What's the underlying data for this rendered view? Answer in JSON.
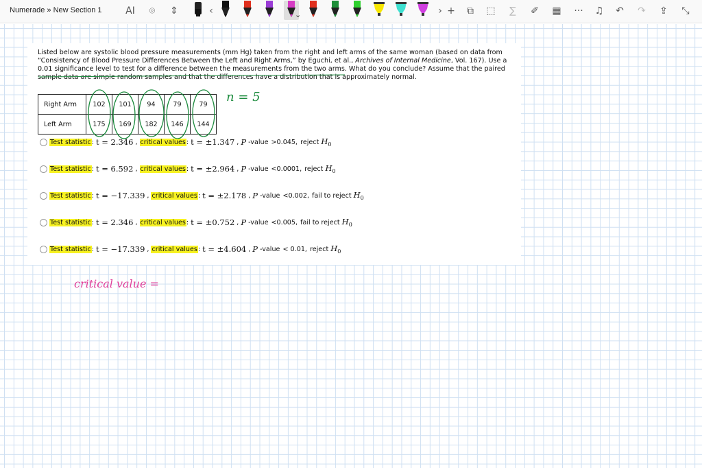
{
  "toolbar": {
    "breadcrumb": "Numerade » New Section 1",
    "left_tools": [
      {
        "icon": "text-select-icon",
        "glyph": "AI"
      },
      {
        "icon": "lasso-select-icon",
        "glyph": "⌾"
      },
      {
        "icon": "add-space-icon",
        "glyph": "⇕"
      }
    ],
    "pens": [
      {
        "color": "#111111",
        "kind": "marker"
      },
      {
        "color": "#111111",
        "kind": "pen"
      },
      {
        "color": "#e0301e",
        "kind": "pen"
      },
      {
        "color": "#9b3dd6",
        "kind": "pen"
      },
      {
        "color": "#d63cc4",
        "kind": "pen",
        "selected": true
      },
      {
        "color": "#e0301e",
        "kind": "pen"
      },
      {
        "color": "#1f8f3a",
        "kind": "pen"
      },
      {
        "color": "#2fd12f",
        "kind": "pen"
      },
      {
        "color": "#f7e600",
        "kind": "highlighter"
      },
      {
        "color": "#3fe0d0",
        "kind": "highlighter"
      },
      {
        "color": "#d040e0",
        "kind": "highlighter"
      }
    ],
    "right_tools": [
      {
        "icon": "add-pen-icon",
        "glyph": "+",
        "dim": false
      },
      {
        "icon": "shapes-icon",
        "glyph": "⧉",
        "dim": false
      },
      {
        "icon": "ink-to-shape-icon",
        "glyph": "⬚",
        "dim": false
      },
      {
        "icon": "ink-to-math-icon",
        "glyph": "∑",
        "dim": true
      },
      {
        "icon": "ruler-icon",
        "glyph": "✐",
        "dim": false
      },
      {
        "icon": "grid-icon",
        "glyph": "▦",
        "dim": false
      },
      {
        "icon": "more-icon",
        "glyph": "···",
        "dim": false
      },
      {
        "icon": "replay-icon",
        "glyph": "♫",
        "dim": false
      },
      {
        "icon": "undo-icon",
        "glyph": "↶",
        "dim": false
      },
      {
        "icon": "redo-icon",
        "glyph": "↷",
        "dim": true
      },
      {
        "icon": "share-icon",
        "glyph": "⇪",
        "dim": false
      },
      {
        "icon": "collapse-icon",
        "glyph": "⤡",
        "dim": false
      }
    ]
  },
  "question": {
    "text_1": "Listed below are systolic blood pressure measurements (mm Hg) taken from the right and left arms of the same woman (based on data from “Consistency of Blood Pressure Differences Between the Left and Right Arms,” by Eguchi, et al., ",
    "journal": "Archives of Internal Medicine",
    "text_2": ", Vol. 167). Use a 0.01 significance level to test for a difference between the measurements from the two arms. What do you conclude? Assume that the paired sample data are simple random samples and that the differences have a distribution that is approximately normal."
  },
  "table": {
    "rows": [
      {
        "label": "Right Arm",
        "values": [
          "102",
          "101",
          "94",
          "79",
          "79"
        ]
      },
      {
        "label": "Left Arm",
        "values": [
          "175",
          "169",
          "182",
          "146",
          "144"
        ]
      }
    ]
  },
  "options": [
    {
      "ts_label": "Test statistic",
      "t": "t = 2.346",
      "cv_label": "critical values",
      "cv": "t = ±1.347",
      "p": ">0.045",
      "conclusion": "reject"
    },
    {
      "ts_label": "Test statistic",
      "t": "t = 6.592",
      "cv_label": "critical values",
      "cv": "t = ±2.964",
      "p": "<0.0001",
      "conclusion": "reject"
    },
    {
      "ts_label": "Test statistic",
      "t": "t = −17.339",
      "cv_label": "critical values",
      "cv": "t = ±2.178",
      "p": "<0.002",
      "conclusion": "fail to reject"
    },
    {
      "ts_label": "Test statistic",
      "t": "t = 2.346",
      "cv_label": "critical values",
      "cv": "t = ±0.752",
      "p": "<0.005",
      "conclusion": "fail to reject"
    },
    {
      "ts_label": "Test statistic",
      "t": "t = −17.339",
      "cv_label": "critical values",
      "cv": "t = ±4.604",
      "p": "< 0.01",
      "conclusion": "reject"
    }
  ],
  "option_parts": {
    "p_prefix": "-value",
    "h0": "H",
    "h0_sub": "0",
    "comma": ","
  },
  "annotations": {
    "n_note": "n = 5",
    "critical_note": "critical value =",
    "green": "#1a8a3c",
    "pink": "#e0409a"
  }
}
